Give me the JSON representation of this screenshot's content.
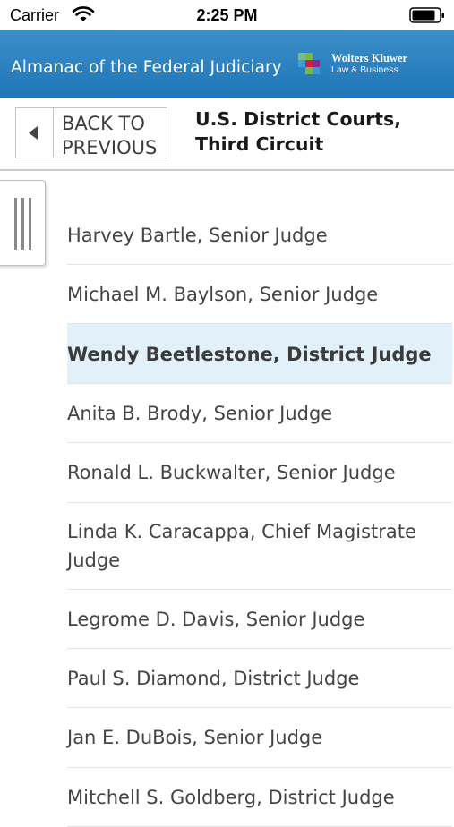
{
  "status_bar": {
    "carrier": "Carrier",
    "time": "2:25 PM"
  },
  "header": {
    "app_title": "Almanac of the Federal Judiciary",
    "brand_name": "Wolters Kluwer",
    "brand_sub": "Law & Business",
    "background_color": "#2a82c0",
    "logo_colors": [
      "#7ab648",
      "#d11e48",
      "#8a2a8e",
      "#3aa0d8"
    ]
  },
  "nav": {
    "back_label": "BACK TO\nPREVIOUS",
    "title": "U.S. District Courts,\nThird Circuit"
  },
  "judges": [
    {
      "label": "Harvey Bartle, Senior Judge",
      "selected": false
    },
    {
      "label": "Michael M. Baylson, Senior Judge",
      "selected": false
    },
    {
      "label": "Wendy Beetlestone, District Judge",
      "selected": true
    },
    {
      "label": "Anita B. Brody, Senior Judge",
      "selected": false
    },
    {
      "label": "Ronald L. Buckwalter, Senior Judge",
      "selected": false
    },
    {
      "label": "Linda K. Caracappa, Chief Magistrate Judge",
      "selected": false
    },
    {
      "label": "Legrome D. Davis, Senior Judge",
      "selected": false
    },
    {
      "label": "Paul S. Diamond, District Judge",
      "selected": false
    },
    {
      "label": "Jan E. DuBois, Senior Judge",
      "selected": false
    },
    {
      "label": "Mitchell S. Goldberg, District Judge",
      "selected": false
    }
  ],
  "colors": {
    "selected_row": "#e2f0fa"
  }
}
